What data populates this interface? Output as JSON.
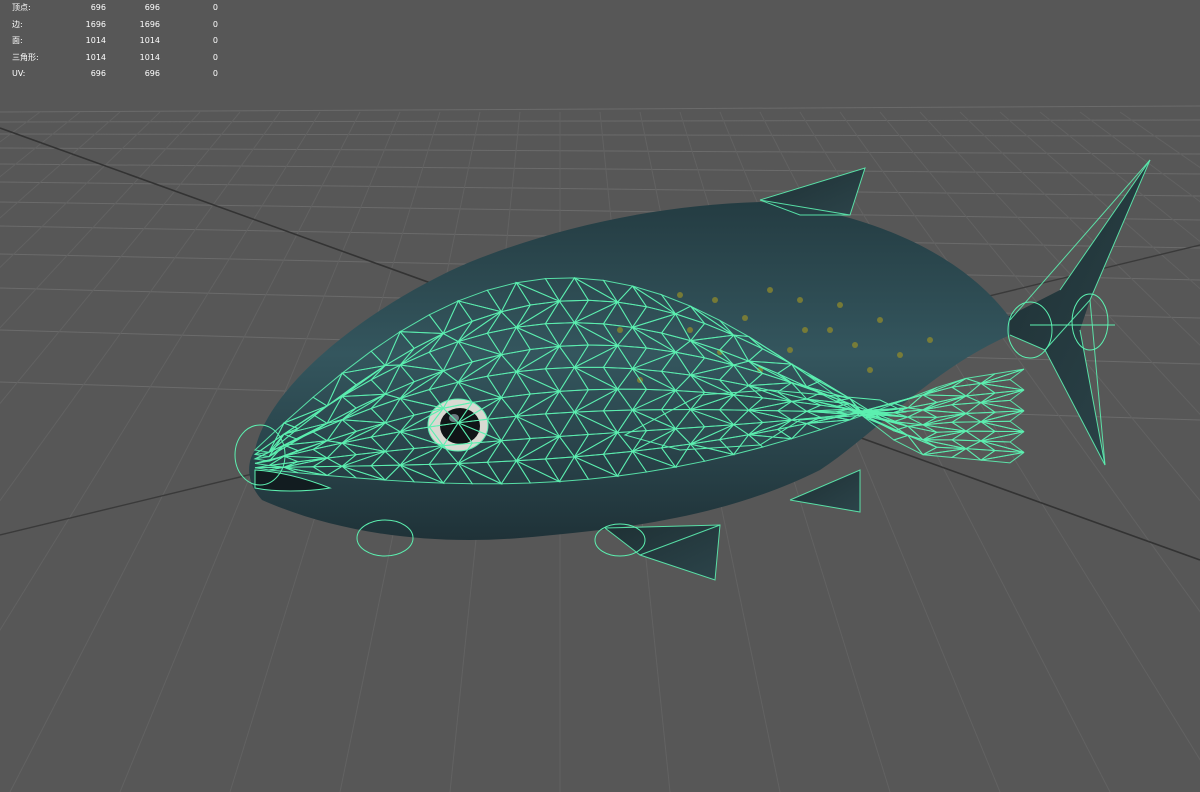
{
  "hud": {
    "rows": [
      {
        "label": "顶点:",
        "c1": "696",
        "c2": "696",
        "c3": "0"
      },
      {
        "label": "边:",
        "c1": "1696",
        "c2": "1696",
        "c3": "0"
      },
      {
        "label": "面:",
        "c1": "1014",
        "c2": "1014",
        "c3": "0"
      },
      {
        "label": "三角形:",
        "c1": "1014",
        "c2": "1014",
        "c3": "0"
      },
      {
        "label": "UV:",
        "c1": "696",
        "c2": "696",
        "c3": "0"
      }
    ]
  },
  "colors": {
    "background": "#575757",
    "grid": "#6e6e6e",
    "grid_axis": "#2e2e2e",
    "wireframe": "#5cf0b0",
    "fish_body": "#2f4e55"
  },
  "scene": {
    "object": "fish-mesh",
    "display_mode": "wireframe-on-shaded"
  }
}
